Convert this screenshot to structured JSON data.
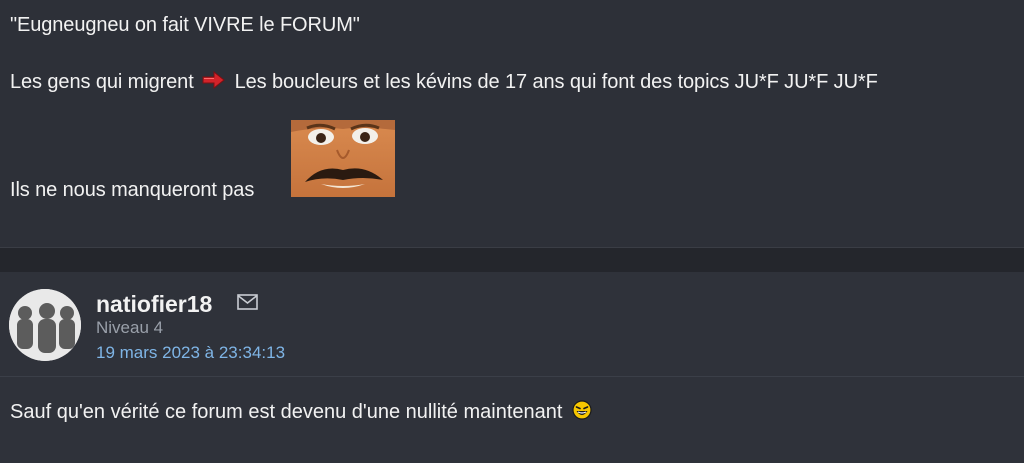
{
  "previous_post": {
    "quote_text": "\"Eugneugneu on fait VIVRE le FORUM\"",
    "migrate_prefix": "Les gens qui migrent",
    "migrate_suffix": "Les boucleurs et les kévins de 17 ans qui font des topics JU*F JU*F JU*F",
    "final_text": "Ils ne nous manqueront pas",
    "arrow_icon": "red-arrow-right-icon",
    "sticker_icon": "risitas-sticker"
  },
  "post": {
    "username": "natiofier18",
    "level": "Niveau 4",
    "date": "19 mars 2023 à 23:34:13",
    "message": "Sauf qu'en vérité ce forum est devenu d'une nullité maintenant",
    "mail_icon": "envelope-icon",
    "smiley_icon": "laughing-smiley-icon"
  },
  "colors": {
    "background": "#2d3038",
    "text": "#f2f2f2",
    "date_link": "#7fb5e6",
    "level_text": "#9aa0aa"
  }
}
